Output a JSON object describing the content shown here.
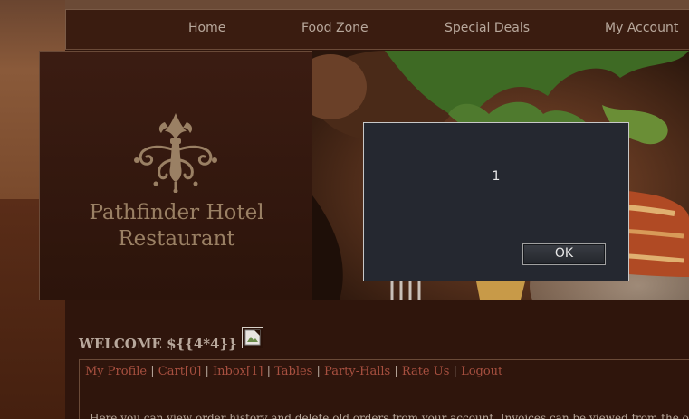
{
  "nav": {
    "items": [
      {
        "label": "Home"
      },
      {
        "label": "Food Zone"
      },
      {
        "label": "Special Deals"
      },
      {
        "label": "My Account"
      }
    ]
  },
  "brand": {
    "line1": "Pathfinder Hotel",
    "line2": "Restaurant"
  },
  "content": {
    "welcome": "WELCOME ${{4*4}}",
    "menu": {
      "links": [
        {
          "label": "My Profile"
        },
        {
          "label": "Cart[0]"
        },
        {
          "label": "Inbox[1]"
        },
        {
          "label": "Tables"
        },
        {
          "label": "Party-Halls"
        },
        {
          "label": "Rate Us"
        },
        {
          "label": "Logout"
        }
      ],
      "separator": "|"
    },
    "info": "Here you can view order history and delete old orders from your account. Invoices can be viewed from the o"
  },
  "dialog": {
    "message": "1",
    "ok_label": "OK"
  },
  "icons": {
    "broken_image": "broken-image-icon",
    "logo": "fleur-emblem-icon"
  },
  "colors": {
    "background": "#2e150c",
    "nav_text": "#b8a89c",
    "brand_text": "#9a8064",
    "link": "#a85040",
    "dialog_bg": "#252830"
  }
}
